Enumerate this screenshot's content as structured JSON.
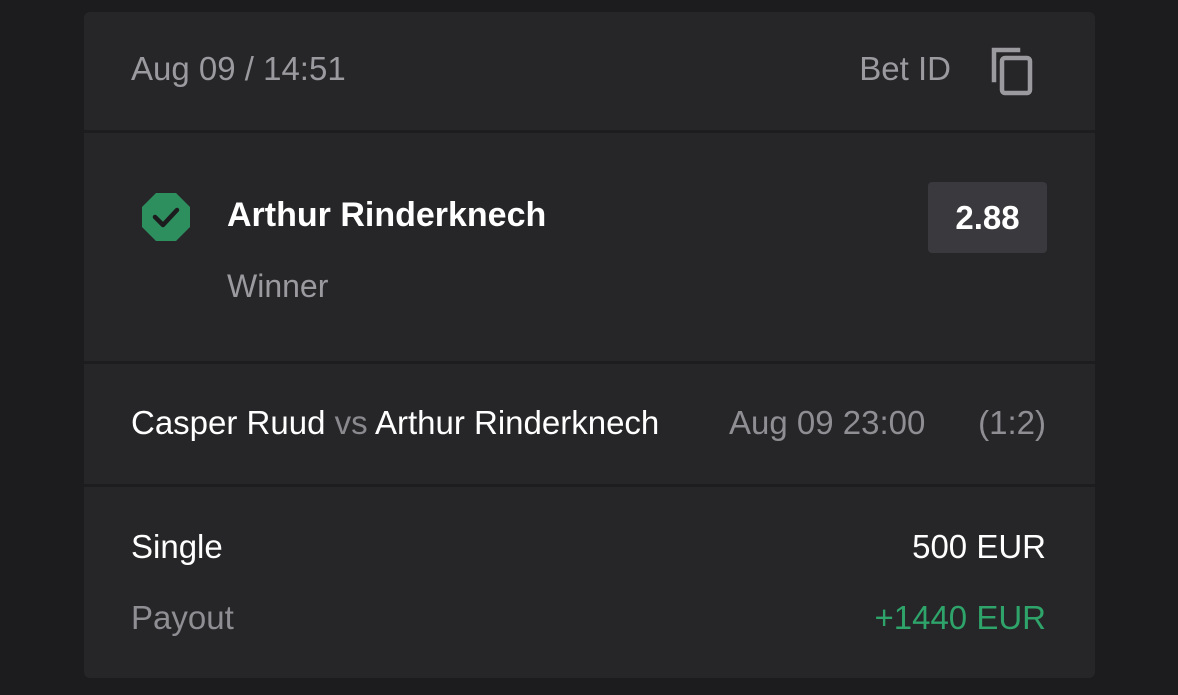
{
  "header": {
    "date_time": "Aug 09 / 14:51",
    "bet_id_label": "Bet ID",
    "copy_icon": "copy-icon"
  },
  "selection": {
    "status_icon": "check-icon",
    "status_color": "#2e8f5e",
    "name": "Arthur Rinderknech",
    "market": "Winner",
    "odds": "2.88"
  },
  "event": {
    "player1": "Casper Ruud",
    "vs": "vs",
    "player2": "Arthur Rinderknech",
    "date_time": "Aug 09 23:00",
    "score": "(1:2)"
  },
  "summary": {
    "bet_type": "Single",
    "stake": "500 EUR",
    "payout_label": "Payout",
    "payout_value": "+1440 EUR",
    "payout_color": "#2ea36a"
  }
}
